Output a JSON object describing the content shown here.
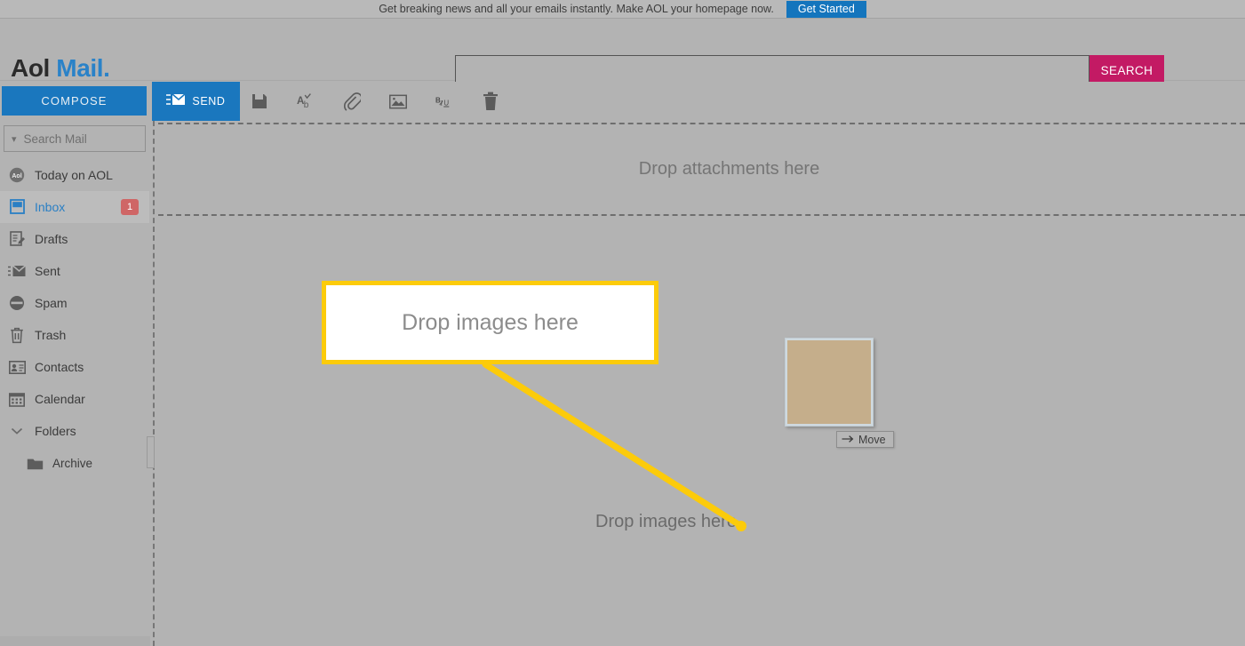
{
  "promo": {
    "text": "Get breaking news and all your emails instantly. Make AOL your homepage now.",
    "button_label": "Get Started",
    "button_color": "#1475bd"
  },
  "brand": {
    "name_part1": "Aol",
    "name_part2": "Mail.",
    "color_part1": "#2b2b2b",
    "color_part2": "#2a82c8"
  },
  "search": {
    "value": "",
    "placeholder": "",
    "button_label": "SEARCH",
    "button_color": "#c31a64"
  },
  "toolbar": {
    "compose_label": "COMPOSE",
    "send_label": "SEND",
    "accent_color": "#1a77be",
    "icons": [
      {
        "name": "save-icon",
        "title": "Save"
      },
      {
        "name": "spellcheck-icon",
        "title": "Spell check"
      },
      {
        "name": "attachment-icon",
        "title": "Attach file"
      },
      {
        "name": "insert-image-icon",
        "title": "Insert image"
      },
      {
        "name": "text-format-icon",
        "title": "Text format"
      },
      {
        "name": "delete-icon",
        "title": "Delete"
      }
    ]
  },
  "sidebar": {
    "search_placeholder": "Search Mail",
    "search_value": "",
    "items": [
      {
        "label": "Today on AOL",
        "icon": "aol-circle-icon",
        "active": false,
        "badge": ""
      },
      {
        "label": "Inbox",
        "icon": "inbox-icon",
        "active": true,
        "badge": "1"
      },
      {
        "label": "Drafts",
        "icon": "drafts-icon",
        "active": false,
        "badge": ""
      },
      {
        "label": "Sent",
        "icon": "sent-icon",
        "active": false,
        "badge": ""
      },
      {
        "label": "Spam",
        "icon": "spam-icon",
        "active": false,
        "badge": ""
      },
      {
        "label": "Trash",
        "icon": "trash-icon",
        "active": false,
        "badge": ""
      },
      {
        "label": "Contacts",
        "icon": "contacts-icon",
        "active": false,
        "badge": ""
      },
      {
        "label": "Calendar",
        "icon": "calendar-icon",
        "active": false,
        "badge": ""
      },
      {
        "label": "Folders",
        "icon": "chevron-down-icon",
        "active": false,
        "badge": ""
      },
      {
        "label": "Archive",
        "icon": "folder-icon",
        "active": false,
        "badge": ""
      }
    ],
    "badge_color": "#cf6666",
    "active_color": "#2a7fc4"
  },
  "compose": {
    "attachments_dropzone_label": "Drop attachments here",
    "images_dropzone_label": "Drop images here",
    "callout_label": "Drop images here",
    "callout_border_color": "#fccb0a",
    "move_tooltip_label": "Move"
  }
}
